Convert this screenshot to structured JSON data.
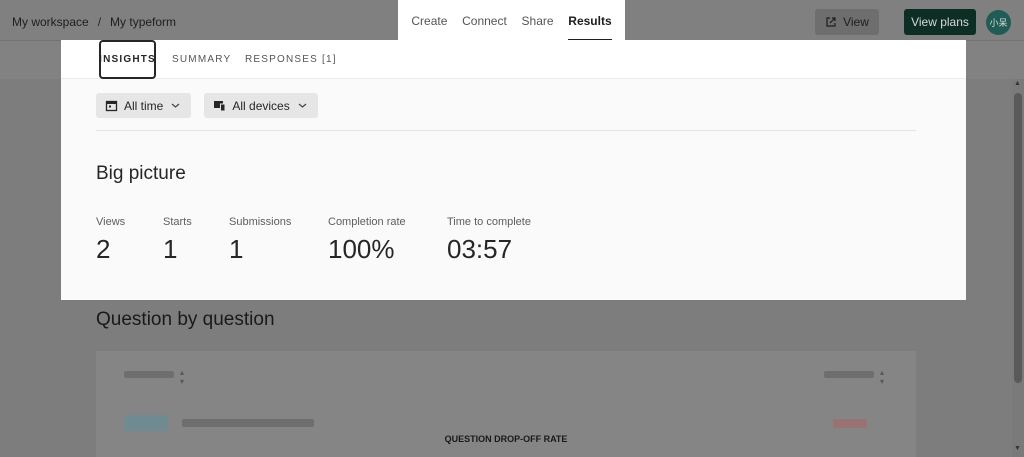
{
  "breadcrumb": {
    "workspace": "My workspace",
    "separator": "/",
    "form": "My typeform"
  },
  "nav": [
    "Create",
    "Connect",
    "Share",
    "Results"
  ],
  "nav_active": "Results",
  "actions": {
    "view": "View",
    "plans": "View plans",
    "avatar": "小呆"
  },
  "tabs": {
    "insights": "INSIGHTS",
    "summary": "SUMMARY",
    "responses": "RESPONSES [1]"
  },
  "filters": {
    "time": "All time",
    "devices": "All devices"
  },
  "big_picture": {
    "title": "Big picture",
    "stats": [
      {
        "label": "Views",
        "value": "2"
      },
      {
        "label": "Starts",
        "value": "1"
      },
      {
        "label": "Submissions",
        "value": "1"
      },
      {
        "label": "Completion rate",
        "value": "100%"
      },
      {
        "label": "Time to complete",
        "value": "03:57"
      }
    ]
  },
  "question_section": {
    "title": "Question by question",
    "dropoff_label": "QUESTION DROP-OFF RATE"
  },
  "icons": {
    "view": "external-link-icon",
    "time": "calendar-icon",
    "devices": "devices-icon",
    "dropdown": "chevron-down-icon"
  }
}
